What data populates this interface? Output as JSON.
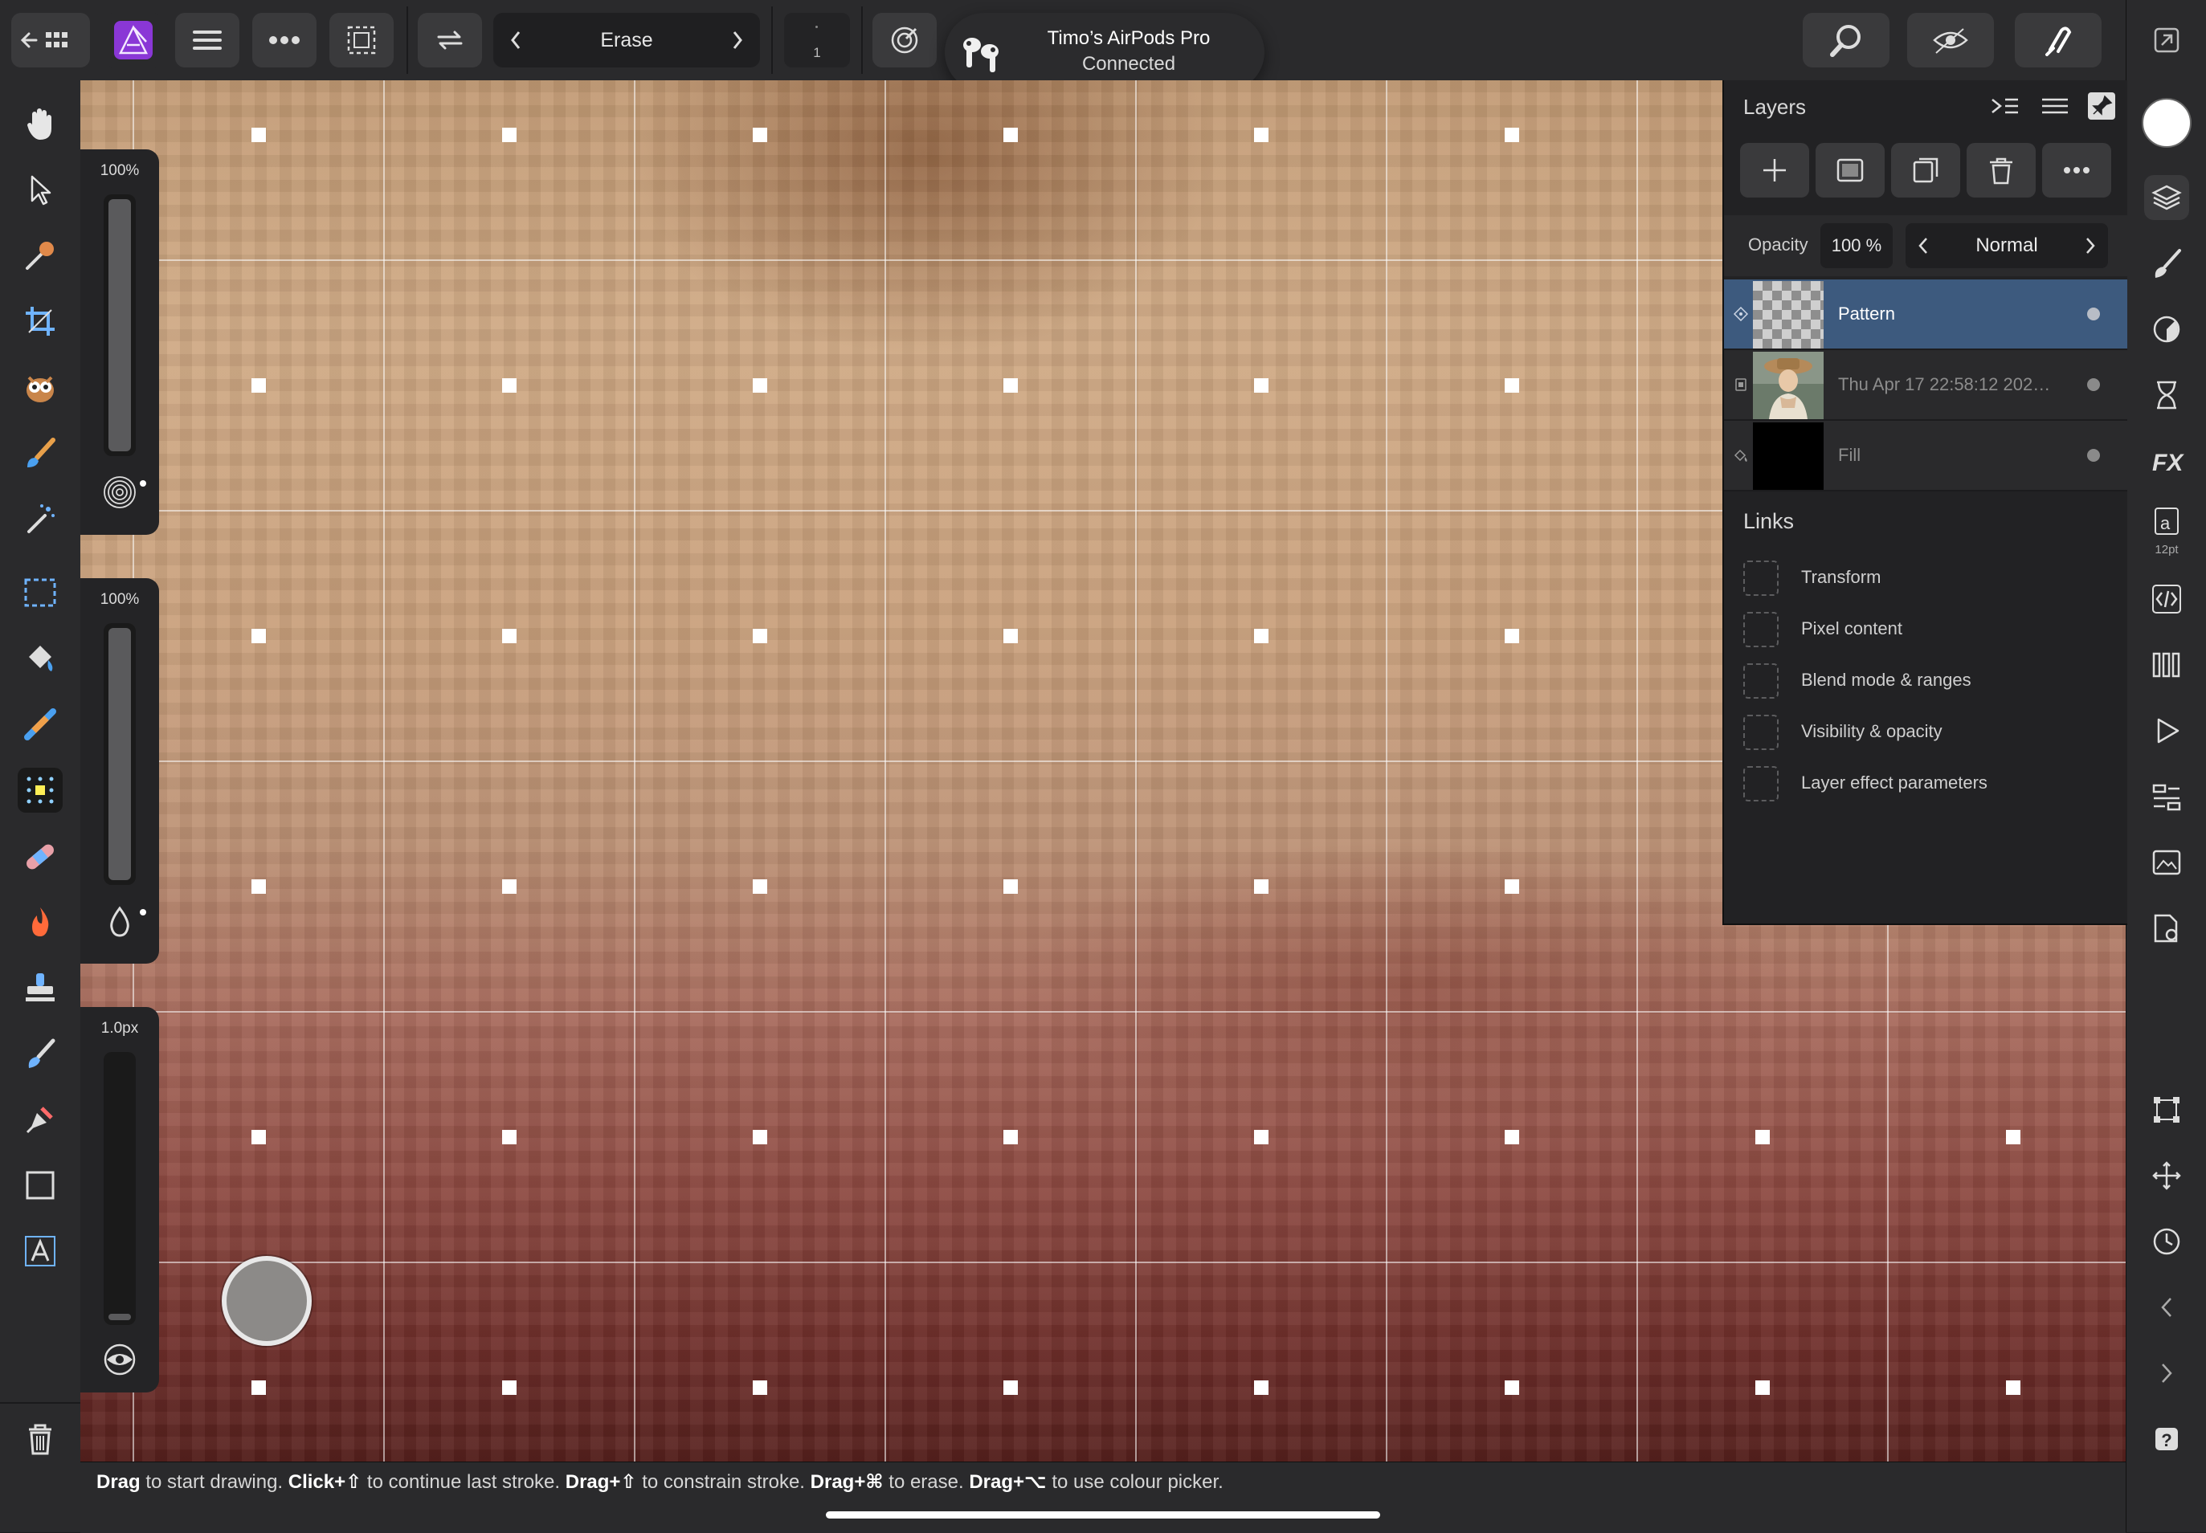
{
  "toolbar": {
    "tool_selector": "Erase",
    "stepper_value": "1"
  },
  "notification": {
    "title": "Timo’s AirPods Pro",
    "subtitle": "Connected"
  },
  "sliders": {
    "opacity": {
      "label": "100%",
      "level": 1.0
    },
    "flow": {
      "label": "100%",
      "level": 1.0
    },
    "width": {
      "label": "1.0px",
      "level": 0.02
    }
  },
  "layers_panel": {
    "title": "Layers",
    "opacity_label": "Opacity",
    "opacity_value": "100 %",
    "blend_mode": "Normal",
    "layers": [
      {
        "name": "Pattern",
        "selected": true
      },
      {
        "name": "Thu Apr 17 22:58:12 202…",
        "selected": false
      },
      {
        "name": "Fill",
        "selected": false
      }
    ],
    "links_title": "Links",
    "links": [
      {
        "label": "Transform"
      },
      {
        "label": "Pixel content"
      },
      {
        "label": "Blend mode & ranges"
      },
      {
        "label": "Visibility & opacity"
      },
      {
        "label": "Layer effect parameters"
      }
    ]
  },
  "right_bar": {
    "text_style_size": "12pt"
  },
  "status": {
    "parts": [
      {
        "key": "Drag",
        "text": " to start drawing. "
      },
      {
        "key": "Click+⇧",
        "text": " to continue last stroke. "
      },
      {
        "key": "Drag+⇧",
        "text": " to constrain stroke. "
      },
      {
        "key": "Drag+⌘",
        "text": " to erase. "
      },
      {
        "key": "Drag+⌥",
        "text": " to use colour picker."
      }
    ]
  },
  "colors": {
    "accent_selected_layer": "#3d5a7e",
    "app_icon_purple": "#8a37d6",
    "colour_swatch": "#ffffff"
  }
}
